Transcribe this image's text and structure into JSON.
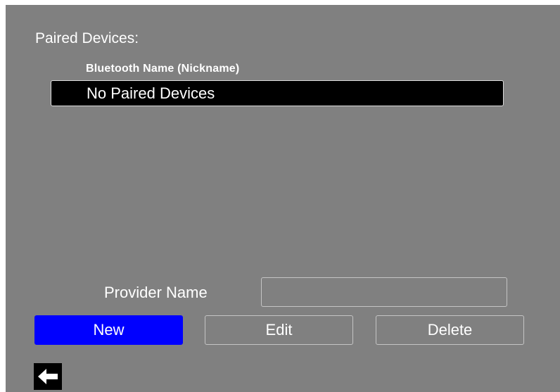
{
  "paired_devices": {
    "title": "Paired Devices:",
    "column_header": "Bluetooth Name (Nickname)",
    "items": [
      "No Paired Devices"
    ]
  },
  "provider": {
    "label": "Provider Name",
    "value": ""
  },
  "buttons": {
    "new_label": "New",
    "edit_label": "Edit",
    "delete_label": "Delete"
  },
  "navigation": {
    "back_icon": "left-arrow-icon"
  },
  "colors": {
    "background": "#808080",
    "selected_row": "#000000",
    "primary_button": "#0000ff",
    "text": "#ffffff"
  }
}
